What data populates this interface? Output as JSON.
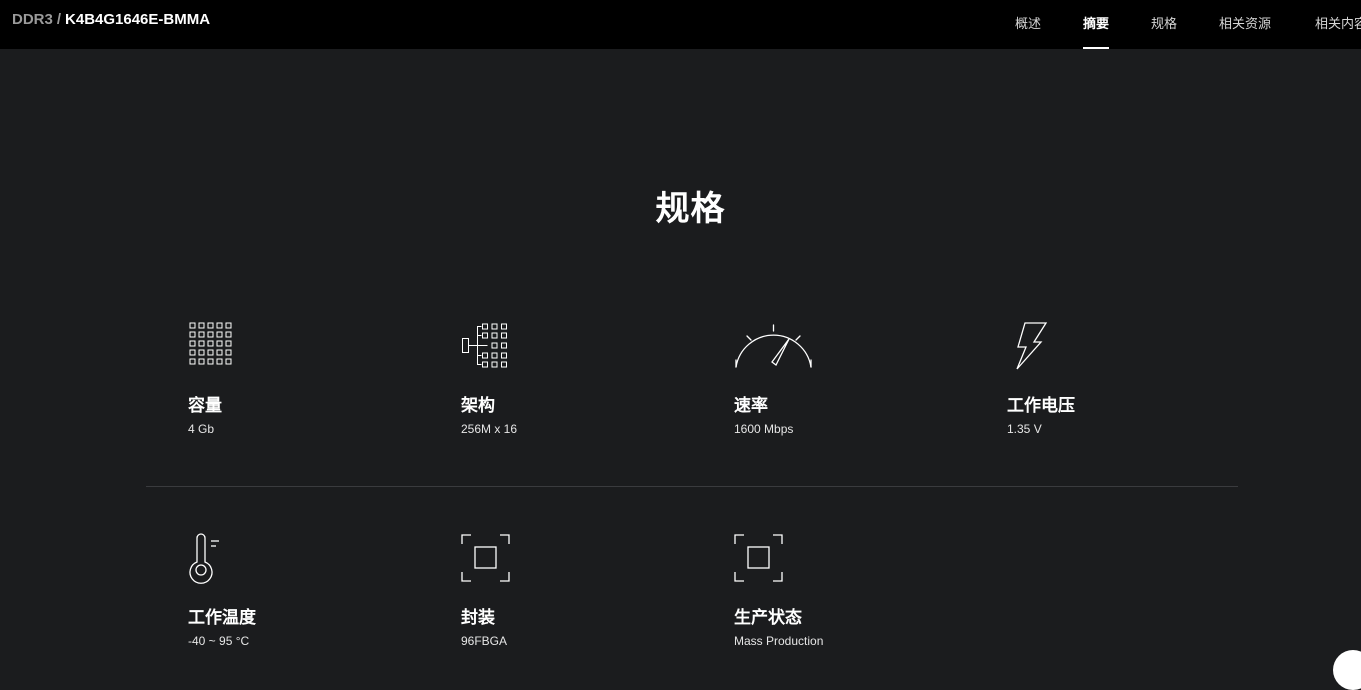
{
  "header": {
    "breadcrumb_category": "DDR3",
    "breadcrumb_separator": "/",
    "model": "K4B4G1646E-BMMA",
    "nav": [
      {
        "label": "概述",
        "active": false
      },
      {
        "label": "摘要",
        "active": true
      },
      {
        "label": "规格",
        "active": false
      },
      {
        "label": "相关资源",
        "active": false
      },
      {
        "label": "相关内容",
        "active": false
      }
    ]
  },
  "section": {
    "title": "规格"
  },
  "specs": [
    {
      "icon": "capacity-grid-icon",
      "label": "容量",
      "value": "4 Gb"
    },
    {
      "icon": "organization-tree-icon",
      "label": "架构",
      "value": "256M x 16"
    },
    {
      "icon": "speedometer-icon",
      "label": "速率",
      "value": "1600 Mbps"
    },
    {
      "icon": "lightning-bolt-icon",
      "label": "工作电压",
      "value": "1.35 V"
    },
    {
      "icon": "thermometer-icon",
      "label": "工作温度",
      "value": "-40 ~ 95 °C"
    },
    {
      "icon": "package-frame-icon",
      "label": "封装",
      "value": "96FBGA"
    },
    {
      "icon": "package-frame-icon",
      "label": "生产状态",
      "value": "Mass Production"
    }
  ],
  "colors": {
    "background": "#1b1c1e",
    "topbar": "#000000",
    "text": "#ffffff",
    "muted": "#9a9a9a",
    "divider": "#3a3b3e"
  }
}
